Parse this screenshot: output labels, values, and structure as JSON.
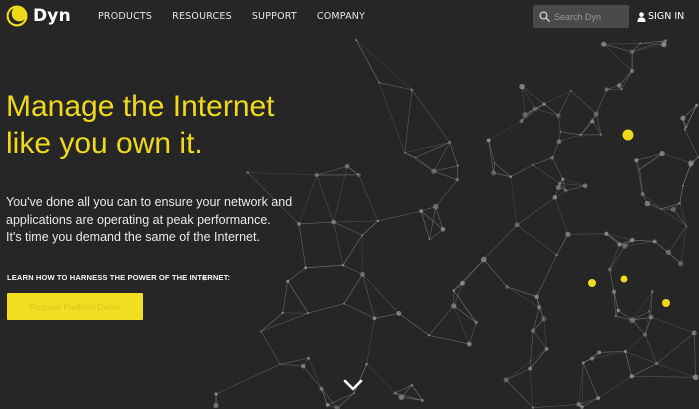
{
  "nav": {
    "logo_text": "Dyn",
    "items": [
      "PRODUCTS",
      "RESOURCES",
      "SUPPORT",
      "COMPANY"
    ],
    "search_placeholder": "Search Dyn",
    "signin_label": "SIGN IN"
  },
  "hero": {
    "headline_line1": "Manage the Internet",
    "headline_line2": "like you own it.",
    "intro_line1": "You've done all you can to ensure your network and",
    "intro_line2": "applications are operating at peak performance.",
    "intro_line3": "It's time you demand the same of the Internet.",
    "cta_heading": "LEARN HOW TO HARNESS THE POWER OF THE INTERNET:",
    "cta_button": "Request Platform Demo"
  },
  "colors": {
    "accent": "#f0d91a",
    "background": "#262626",
    "network_line": "#8a8a8a",
    "network_node": "#a0a0a0"
  },
  "icons": {
    "logo": "dyn-logo-icon",
    "search": "search-icon",
    "user": "user-icon",
    "scroll": "chevron-down-icon"
  }
}
